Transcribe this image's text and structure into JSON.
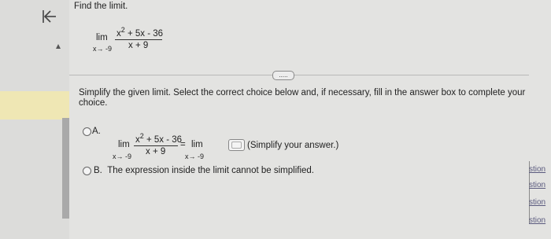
{
  "nav": {
    "back_icon": "back-to-start-icon"
  },
  "question": {
    "prompt": "Find the limit.",
    "lim_word": "lim",
    "lim_sub": "x→ -9",
    "numerator": "x",
    "numerator_exp": "2",
    "numerator_rest": "+ 5x - 36",
    "denominator": "x + 9"
  },
  "more_button": {
    "label": "....."
  },
  "instructions": {
    "line1": "Simplify the given limit. Select the correct choice below and, if necessary, fill in the answer box to complete your",
    "line2": "choice."
  },
  "choice_a": {
    "letter": "A.",
    "lim_word": "lim",
    "lim_sub": "x→ -9",
    "numerator": "x",
    "numerator_exp": "2",
    "numerator_rest": "+ 5x - 36",
    "denominator": "x + 9",
    "equals": "=",
    "rhs_lim_word": "lim",
    "rhs_lim_sub": "x→ -9",
    "hint": "(Simplify your answer.)",
    "answer_value": ""
  },
  "choice_b": {
    "letter": "B.",
    "text": "The expression inside the limit cannot be simplified."
  },
  "right_links": [
    "stion",
    "stion",
    "stion",
    "stion"
  ]
}
